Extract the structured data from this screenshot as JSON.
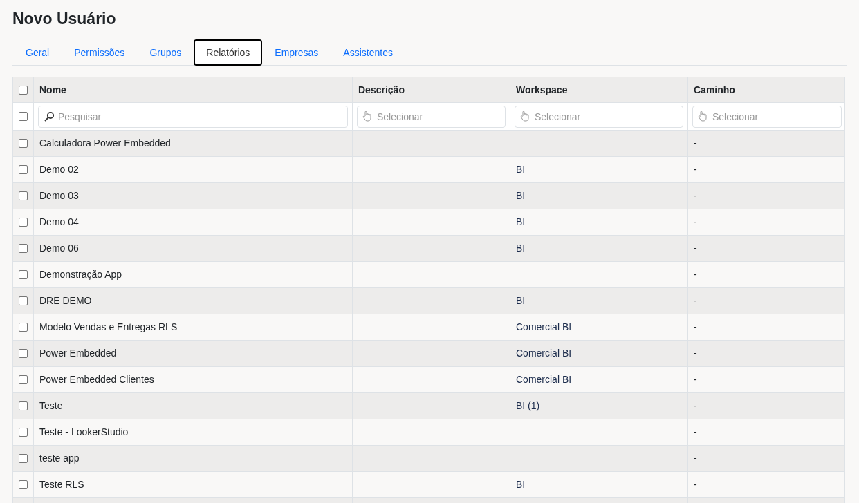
{
  "title": "Novo Usuário",
  "tabs": [
    {
      "label": "Geral",
      "selected": false
    },
    {
      "label": "Permissões",
      "selected": false
    },
    {
      "label": "Grupos",
      "selected": false
    },
    {
      "label": "Relatórios",
      "selected": true
    },
    {
      "label": "Empresas",
      "selected": false
    },
    {
      "label": "Assistentes",
      "selected": false
    }
  ],
  "table": {
    "select_all_checked": false,
    "columns": [
      "Nome",
      "Descrição",
      "Workspace",
      "Caminho"
    ],
    "filters": {
      "checked": false,
      "search_placeholder": "Pesquisar",
      "select_placeholders": [
        "Selecionar",
        "Selecionar",
        "Selecionar"
      ]
    },
    "rows": [
      {
        "checked": false,
        "nome": "Calculadora Power Embedded",
        "descricao": "",
        "workspace": "",
        "caminho": "-"
      },
      {
        "checked": false,
        "nome": "Demo 02",
        "descricao": "",
        "workspace": "BI",
        "caminho": "-"
      },
      {
        "checked": false,
        "nome": "Demo 03",
        "descricao": "",
        "workspace": "BI",
        "caminho": "-"
      },
      {
        "checked": false,
        "nome": "Demo 04",
        "descricao": "",
        "workspace": "BI",
        "caminho": "-"
      },
      {
        "checked": false,
        "nome": "Demo 06",
        "descricao": "",
        "workspace": "BI",
        "caminho": "-"
      },
      {
        "checked": false,
        "nome": "Demonstração App",
        "descricao": "",
        "workspace": "",
        "caminho": "-"
      },
      {
        "checked": false,
        "nome": "DRE DEMO",
        "descricao": "",
        "workspace": "BI",
        "caminho": "-"
      },
      {
        "checked": false,
        "nome": "Modelo Vendas e Entregas RLS",
        "descricao": "",
        "workspace": "Comercial BI",
        "caminho": "-"
      },
      {
        "checked": false,
        "nome": "Power Embedded",
        "descricao": "",
        "workspace": "Comercial BI",
        "caminho": "-"
      },
      {
        "checked": false,
        "nome": "Power Embedded Clientes",
        "descricao": "",
        "workspace": "Comercial BI",
        "caminho": "-"
      },
      {
        "checked": false,
        "nome": "Teste",
        "descricao": "",
        "workspace": "BI (1)",
        "caminho": "-"
      },
      {
        "checked": false,
        "nome": "Teste - LookerStudio",
        "descricao": "",
        "workspace": "",
        "caminho": "-"
      },
      {
        "checked": false,
        "nome": "teste app",
        "descricao": "",
        "workspace": "",
        "caminho": "-"
      },
      {
        "checked": false,
        "nome": "Teste RLS",
        "descricao": "",
        "workspace": "BI",
        "caminho": "-"
      }
    ]
  }
}
